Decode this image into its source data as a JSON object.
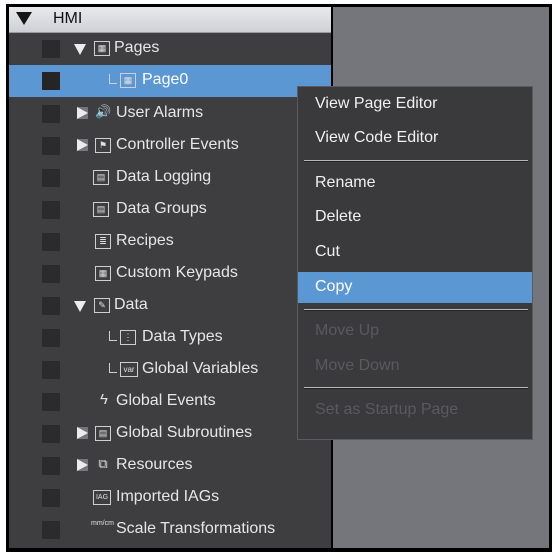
{
  "header": {
    "title": "HMI"
  },
  "tree": {
    "pages": "Pages",
    "page0": "Page0",
    "user_alarms": "User Alarms",
    "controller_events": "Controller Events",
    "data_logging": "Data Logging",
    "data_groups": "Data Groups",
    "recipes": "Recipes",
    "custom_keypads": "Custom Keypads",
    "data": "Data",
    "data_types": "Data Types",
    "global_variables": "Global Variables",
    "global_events": "Global Events",
    "global_subroutines": "Global Subroutines",
    "resources": "Resources",
    "imported_iags": "Imported IAGs",
    "scale_transformations": "Scale Transformations"
  },
  "icons": {
    "var_badge": "var",
    "iag_badge": "IAG",
    "scale_badge": "mm/cm"
  },
  "context_menu": {
    "view_page_editor": "View Page Editor",
    "view_code_editor": "View Code Editor",
    "rename": "Rename",
    "delete": "Delete",
    "cut": "Cut",
    "copy": "Copy",
    "move_up": "Move Up",
    "move_down": "Move Down",
    "set_startup": "Set as Startup Page"
  },
  "colors": {
    "selection": "#5b97d3",
    "panel": "#3e3e40",
    "background": "#74767c"
  }
}
